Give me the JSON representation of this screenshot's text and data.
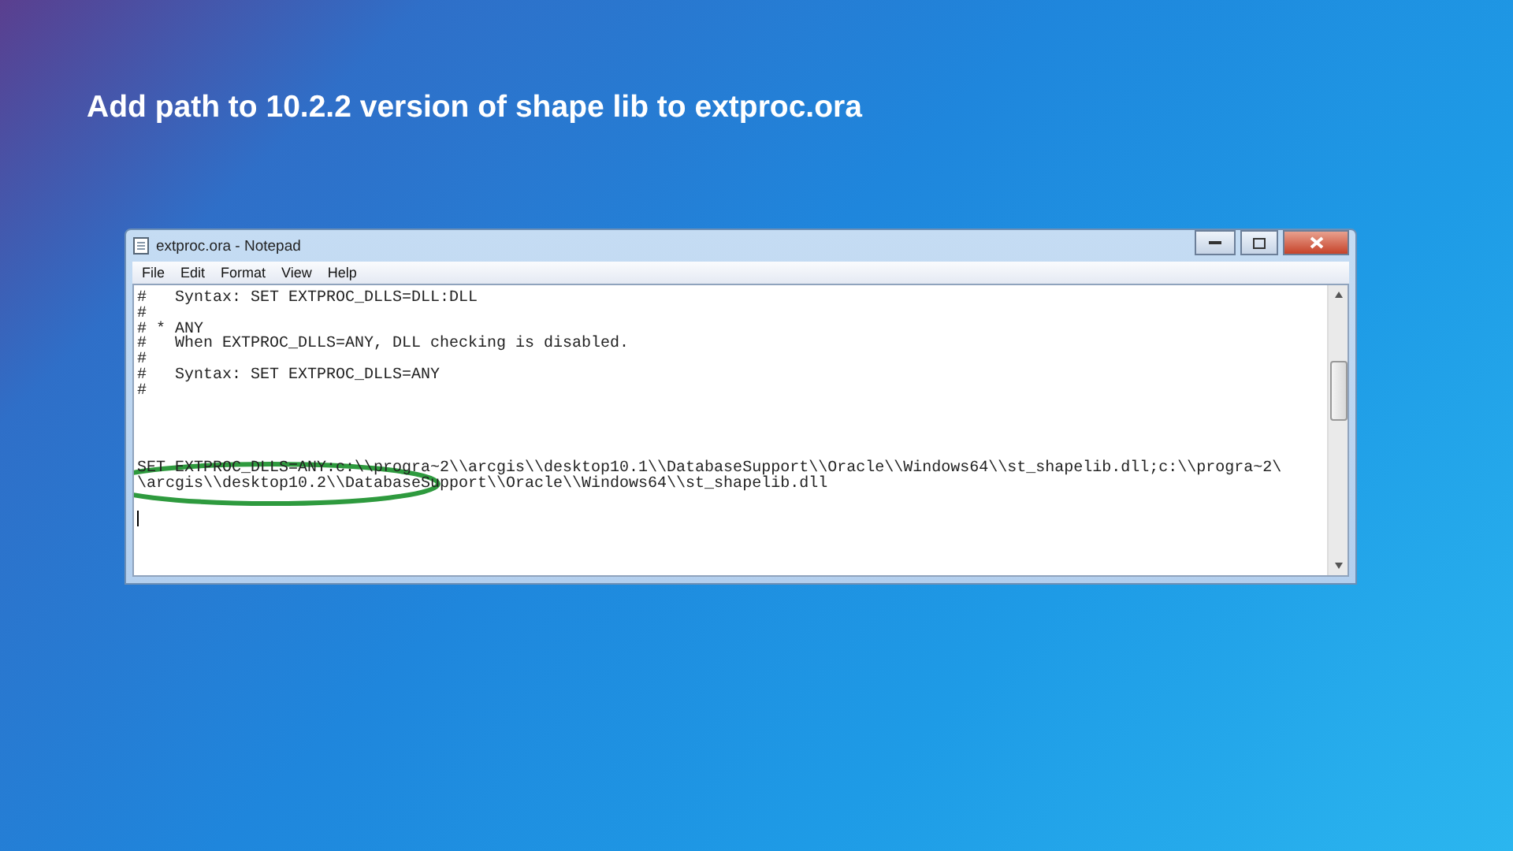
{
  "slide_title": "Add path to 10.2.2 version of shape lib to extproc.ora",
  "window": {
    "title": "extproc.ora - Notepad",
    "menu": [
      "File",
      "Edit",
      "Format",
      "View",
      "Help"
    ],
    "lines": [
      {
        "kind": "text",
        "text": "#   Syntax: SET EXTPROC_DLLS=DLL:DLL"
      },
      {
        "kind": "text",
        "text": "#"
      },
      {
        "kind": "text",
        "text": "# * ANY"
      },
      {
        "kind": "text",
        "text": "#   When EXTPROC_DLLS=ANY, DLL checking is disabled."
      },
      {
        "kind": "text",
        "text": "#"
      },
      {
        "kind": "text",
        "text": "#   Syntax: SET EXTPROC_DLLS=ANY"
      },
      {
        "kind": "text",
        "text": "#"
      },
      {
        "kind": "blank"
      },
      {
        "kind": "blank"
      },
      {
        "kind": "blank"
      },
      {
        "kind": "blank"
      },
      {
        "kind": "text",
        "text": "SET EXTPROC_DLLS=ANY:c:\\\\progra~2\\\\arcgis\\\\desktop10.1\\\\DatabaseSupport\\\\Oracle\\\\Windows64\\\\st_shapelib.dll;c:\\\\progra~2\\"
      },
      {
        "kind": "text",
        "text": "\\arcgis\\\\desktop10.2\\\\DatabaseSupport\\\\Oracle\\\\Windows64\\\\st_shapelib.dll"
      },
      {
        "kind": "blank"
      },
      {
        "kind": "caret"
      }
    ]
  }
}
